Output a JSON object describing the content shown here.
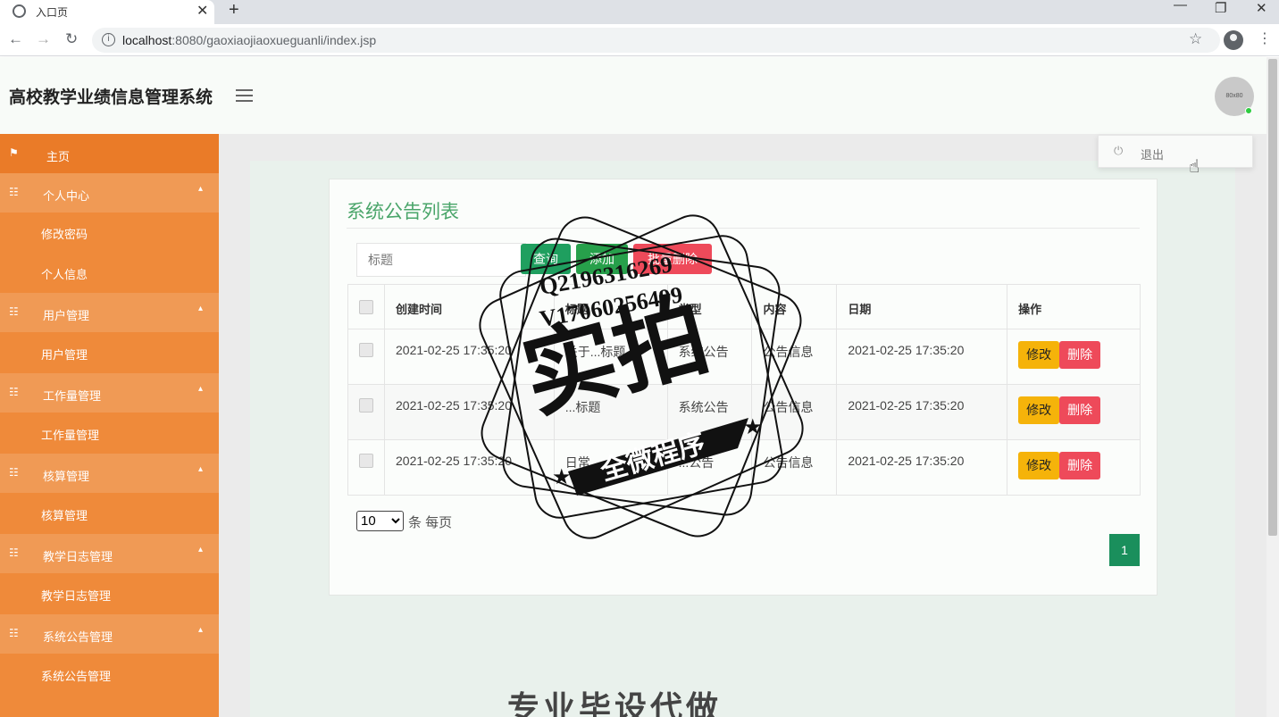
{
  "browser": {
    "tab_title": "入口页",
    "url_host": "localhost",
    "url_rest": ":8080/gaoxiaojiaoxueguanli/index.jsp"
  },
  "header": {
    "app_title": "高校教学业绩信息管理系统",
    "avatar_text": "80x80"
  },
  "user_menu": {
    "logout_label": "退出"
  },
  "sidebar": {
    "home": "主页",
    "groups": [
      {
        "label": "个人中心",
        "children": [
          "修改密码",
          "个人信息"
        ]
      },
      {
        "label": "用户管理",
        "children": [
          "用户管理"
        ]
      },
      {
        "label": "工作量管理",
        "children": [
          "工作量管理"
        ]
      },
      {
        "label": "核算管理",
        "children": [
          "核算管理"
        ]
      },
      {
        "label": "教学日志管理",
        "children": [
          "教学日志管理"
        ]
      },
      {
        "label": "系统公告管理",
        "children": [
          "系统公告管理"
        ]
      }
    ]
  },
  "main": {
    "title": "系统公告列表",
    "search_placeholder": "标题",
    "query_label": "查询",
    "add_label": "添加",
    "batch_delete_label": "批量删除",
    "columns": [
      "创建时间",
      "标题",
      "类型",
      "内容",
      "日期",
      "操作"
    ],
    "rows": [
      {
        "created": "2021-02-25 17:35:20",
        "title": "关于...标题",
        "type": "系统公告",
        "content": "公告信息",
        "date": "2021-02-25 17:35:20"
      },
      {
        "created": "2021-02-25 17:35:20",
        "title": "...标题",
        "type": "系统公告",
        "content": "公告信息",
        "date": "2021-02-25 17:35:20"
      },
      {
        "created": "2021-02-25 17:35:20",
        "title": "日常...",
        "type": "...公告",
        "content": "公告信息",
        "date": "2021-02-25 17:35:20"
      }
    ],
    "edit_label": "修改",
    "delete_label": "删除",
    "page_size": "10",
    "page_size_suffix": "条 每页",
    "current_page": "1"
  },
  "watermark": {
    "line1": "Q2196316269",
    "line2": "V17060256499",
    "main": "实拍",
    "ribbon": "全微程序"
  },
  "bottom_banner": "专业毕设代做"
}
